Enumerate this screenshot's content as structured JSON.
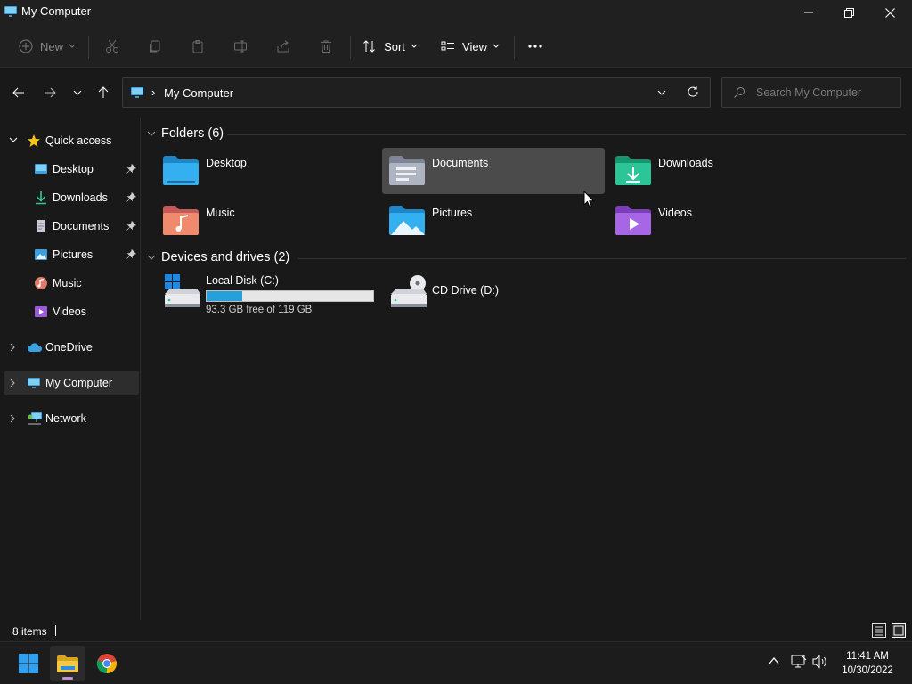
{
  "window": {
    "title": "My Computer"
  },
  "commandbar": {
    "new_label": "New",
    "sort_label": "Sort",
    "view_label": "View"
  },
  "address": {
    "location": "My Computer"
  },
  "search": {
    "placeholder": "Search My Computer"
  },
  "sidebar": {
    "quick_access": "Quick access",
    "items": [
      {
        "label": "Desktop",
        "icon": "desktop-icon",
        "pinned": true
      },
      {
        "label": "Downloads",
        "icon": "downloads-icon",
        "pinned": true
      },
      {
        "label": "Documents",
        "icon": "documents-icon",
        "pinned": true
      },
      {
        "label": "Pictures",
        "icon": "pictures-icon",
        "pinned": true
      },
      {
        "label": "Music",
        "icon": "music-icon",
        "pinned": false
      },
      {
        "label": "Videos",
        "icon": "videos-icon",
        "pinned": false
      }
    ],
    "onedrive": "OneDrive",
    "my_computer": "My Computer",
    "network": "Network"
  },
  "content": {
    "folders_header": "Folders (6)",
    "folders": [
      {
        "label": "Desktop"
      },
      {
        "label": "Documents"
      },
      {
        "label": "Downloads"
      },
      {
        "label": "Music"
      },
      {
        "label": "Pictures"
      },
      {
        "label": "Videos"
      }
    ],
    "devices_header": "Devices and drives (2)",
    "drives": [
      {
        "label": "Local Disk (C:)",
        "free_text": "93.3 GB free of 119 GB",
        "used_fraction": 0.216
      },
      {
        "label": "CD Drive (D:)"
      }
    ]
  },
  "status": {
    "item_count": "8 items"
  },
  "taskbar": {
    "time": "11:41 AM",
    "date": "10/30/2022"
  },
  "colors": {
    "accent": "#26a0da",
    "background": "#191919",
    "folder_blue": "#3aa0e0",
    "hover": "#4b4b4b"
  }
}
